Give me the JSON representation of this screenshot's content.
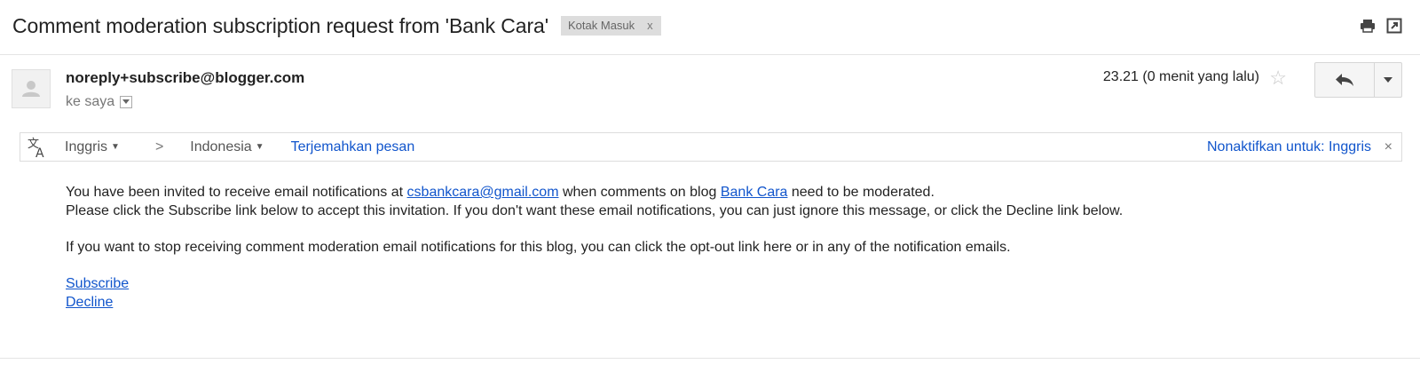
{
  "email": {
    "subject": "Comment moderation subscription request from 'Bank Cara'",
    "label": "Kotak Masuk",
    "label_remove": "x",
    "sender": "noreply+subscribe@blogger.com",
    "recipient": "ke saya",
    "timestamp": "23.21 (0 menit yang lalu)"
  },
  "translate": {
    "source_lang": "Inggris",
    "target_lang": "Indonesia",
    "arrow": ">",
    "translate_label": "Terjemahkan pesan",
    "disable_label": "Nonaktifkan untuk: Inggris",
    "close": "×"
  },
  "body": {
    "line1_a": "You have been invited to receive email notifications at ",
    "email_link": "csbankcara@gmail.com",
    "line1_b": " when comments on blog ",
    "blog_link": "Bank Cara",
    "line1_c": " need to be moderated.",
    "line2": "Please click the Subscribe link below to accept this invitation. If you don't want these email notifications, you can just ignore this message, or click the Decline link below.",
    "line3": "If you want to stop receiving comment moderation email notifications for this blog, you can click the opt-out link here or in any of the notification emails.",
    "subscribe": "Subscribe",
    "decline": "Decline"
  }
}
